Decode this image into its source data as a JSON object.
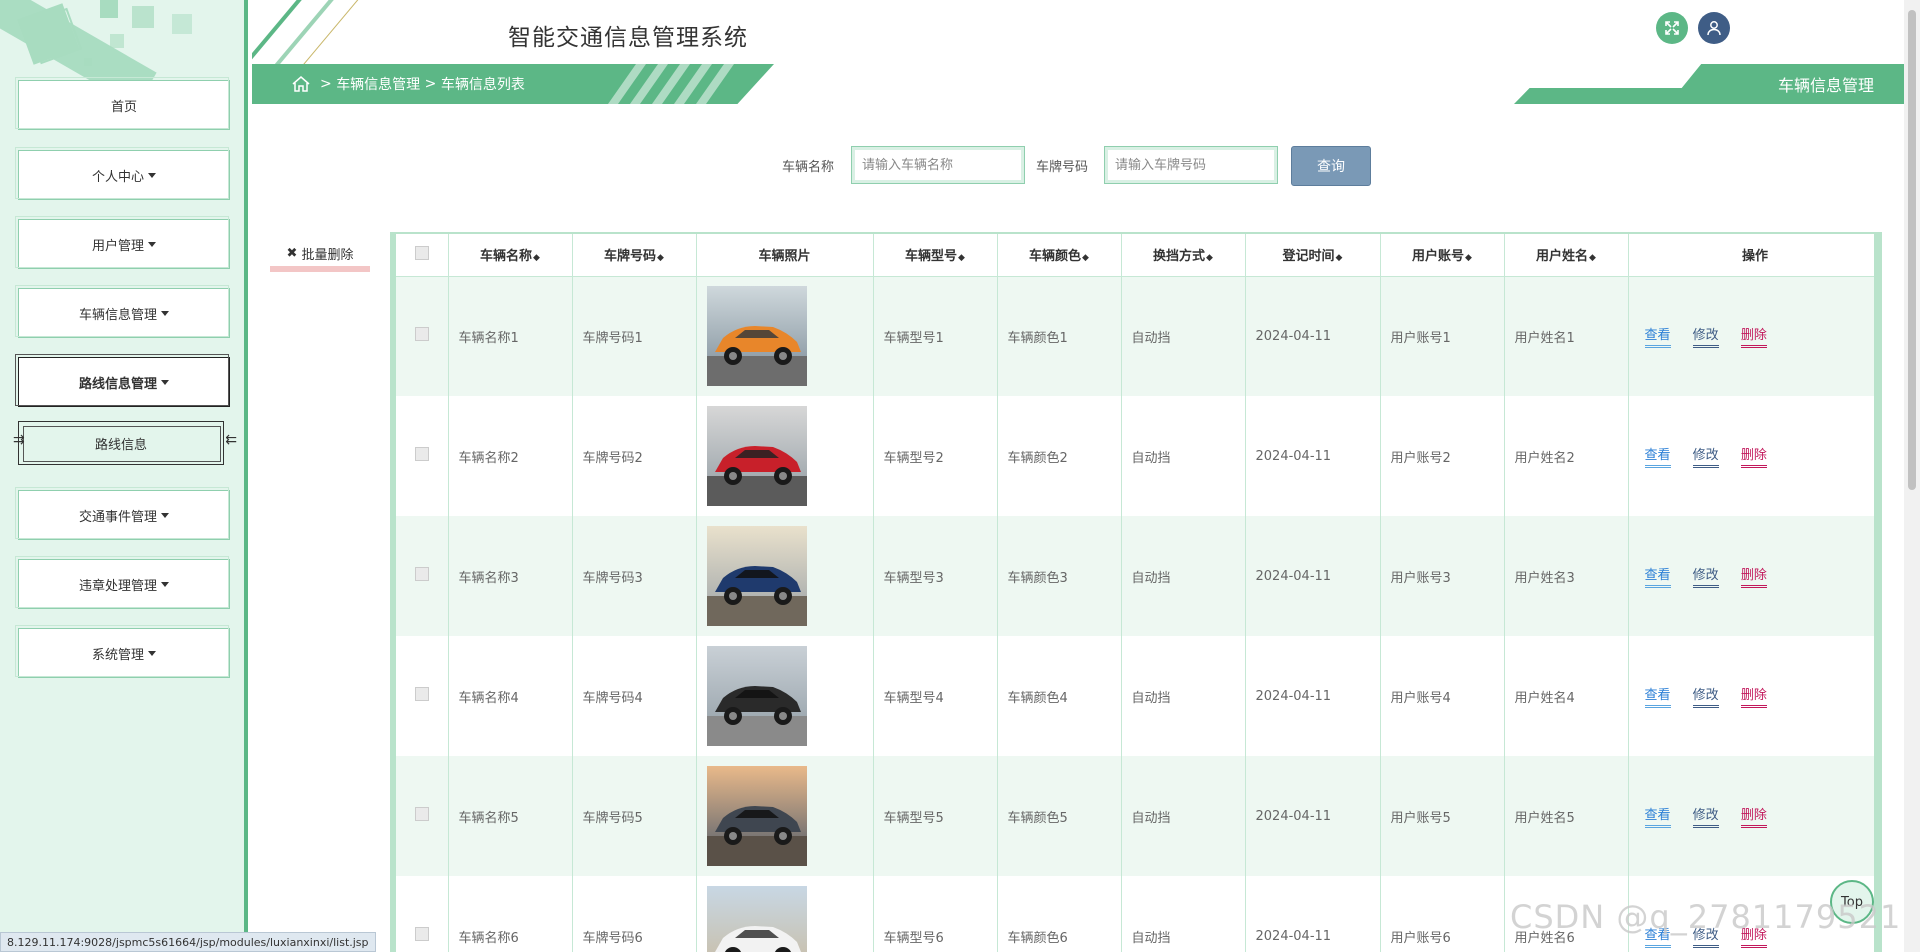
{
  "system_title": "智能交通信息管理系统",
  "sidebar": {
    "items": [
      {
        "label": "首页",
        "has_caret": false
      },
      {
        "label": "个人中心",
        "has_caret": true
      },
      {
        "label": "用户管理",
        "has_caret": true
      },
      {
        "label": "车辆信息管理",
        "has_caret": true
      },
      {
        "label": "路线信息管理",
        "has_caret": true,
        "active": true
      },
      {
        "label": "交通事件管理",
        "has_caret": true
      },
      {
        "label": "违章处理管理",
        "has_caret": true
      },
      {
        "label": "系统管理",
        "has_caret": true
      }
    ],
    "submenu": {
      "label": "路线信息"
    }
  },
  "breadcrumb": {
    "separator": ">",
    "level1": "车辆信息管理",
    "level2": "车辆信息列表"
  },
  "page_tag": "车辆信息管理",
  "search": {
    "name_label": "车辆名称",
    "name_placeholder": "请输入车辆名称",
    "plate_label": "车牌号码",
    "plate_placeholder": "请输入车牌号码",
    "button": "查询"
  },
  "batch_delete": {
    "icon": "✖",
    "label": "批量删除"
  },
  "table": {
    "columns": [
      "车辆名称",
      "车牌号码",
      "车辆照片",
      "车辆型号",
      "车辆颜色",
      "换挡方式",
      "登记时间",
      "用户账号",
      "用户姓名",
      "操作"
    ],
    "rows": [
      {
        "name": "车辆名称1",
        "plate": "车牌号码1",
        "photo": "orange-car",
        "model": "车辆型号1",
        "color": "车辆颜色1",
        "gear": "自动挡",
        "date": "2024-04-11",
        "account": "用户账号1",
        "user": "用户姓名1"
      },
      {
        "name": "车辆名称2",
        "plate": "车牌号码2",
        "photo": "red-car",
        "model": "车辆型号2",
        "color": "车辆颜色2",
        "gear": "自动挡",
        "date": "2024-04-11",
        "account": "用户账号2",
        "user": "用户姓名2"
      },
      {
        "name": "车辆名称3",
        "plate": "车牌号码3",
        "photo": "blue-car",
        "model": "车辆型号3",
        "color": "车辆颜色3",
        "gear": "自动挡",
        "date": "2024-04-11",
        "account": "用户账号3",
        "user": "用户姓名3"
      },
      {
        "name": "车辆名称4",
        "plate": "车牌号码4",
        "photo": "black-suv",
        "model": "车辆型号4",
        "color": "车辆颜色4",
        "gear": "自动挡",
        "date": "2024-04-11",
        "account": "用户账号4",
        "user": "用户姓名4"
      },
      {
        "name": "车辆名称5",
        "plate": "车牌号码5",
        "photo": "grey-suv",
        "model": "车辆型号5",
        "color": "车辆颜色5",
        "gear": "自动挡",
        "date": "2024-04-11",
        "account": "用户账号5",
        "user": "用户姓名5"
      },
      {
        "name": "车辆名称6",
        "plate": "车牌号码6",
        "photo": "white-suv",
        "model": "车辆型号6",
        "color": "车辆颜色6",
        "gear": "自动挡",
        "date": "2024-04-11",
        "account": "用户账号6",
        "user": "用户姓名6"
      }
    ],
    "actions": {
      "view": "查看",
      "edit": "修改",
      "delete": "删除"
    }
  },
  "top_button": "Top",
  "status_url": "8.129.11.174:9028/jspmc5s61664/jsp/modules/luxianxinxi/list.jsp",
  "watermark": "CSDN @q_2781179521",
  "colors": {
    "accent": "#5cb786",
    "sidebar_bg": "#e3f5ec",
    "user_button": "#3f5d86",
    "search_button": "#7a99b6",
    "delete_link": "#c2185b",
    "view_link": "#2b7fd6"
  }
}
